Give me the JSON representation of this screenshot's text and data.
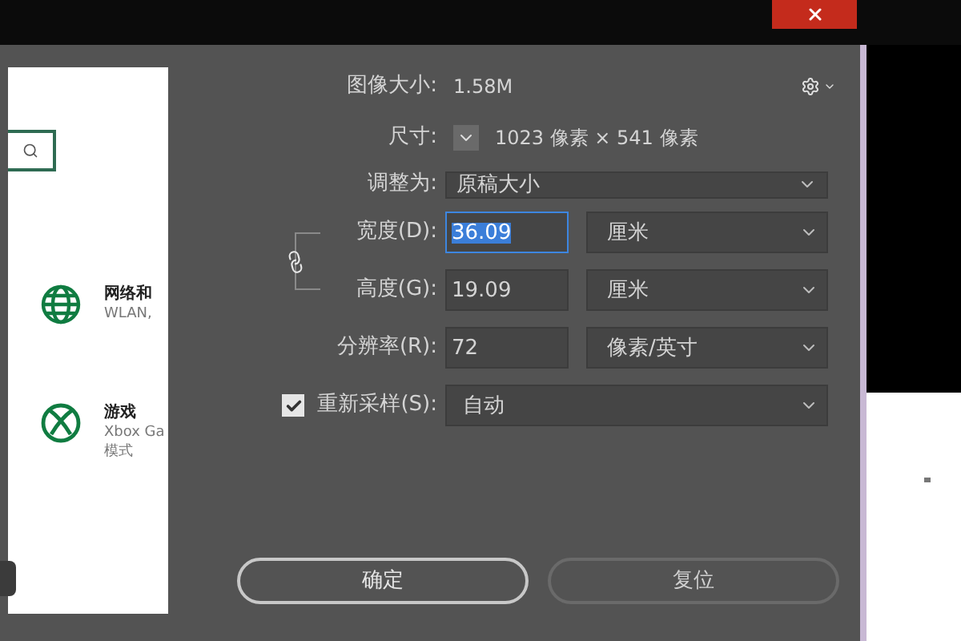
{
  "settings_panel": {
    "items": [
      {
        "kind": "network",
        "title": "网络和",
        "lines": [
          "WLAN,"
        ]
      },
      {
        "kind": "gaming",
        "title": "游戏",
        "lines": [
          "Xbox Ga",
          "模式"
        ]
      }
    ]
  },
  "dialog": {
    "image_size": {
      "label": "图像大小:",
      "value": "1.58M"
    },
    "dimensions": {
      "label": "尺寸:",
      "value": "1023 像素 × 541 像素"
    },
    "fit_to": {
      "label": "调整为:",
      "value": "原稿大小"
    },
    "constrain_proportions": true,
    "fields": [
      {
        "label": "宽度(D):",
        "value": "36.09",
        "focused": true,
        "unit": "厘米"
      },
      {
        "label": "高度(G):",
        "value": "19.09",
        "focused": false,
        "unit": "厘米"
      },
      {
        "label": "分辨率(R):",
        "value": "72",
        "focused": false,
        "unit": "像素/英寸"
      }
    ],
    "resample": {
      "label": "重新采样(S):",
      "checked": true,
      "value": "自动"
    },
    "buttons": [
      {
        "label": "确定",
        "default": true
      },
      {
        "label": "复位",
        "default": false
      }
    ]
  }
}
